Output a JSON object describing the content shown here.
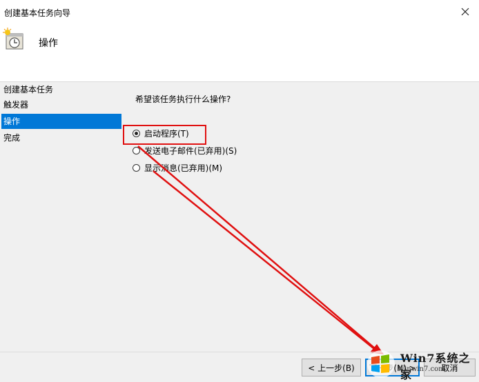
{
  "window": {
    "title": "创建基本任务向导"
  },
  "header": {
    "title": "操作",
    "icon": "task-clock-icon"
  },
  "sidebar": {
    "items": [
      {
        "label": "创建基本任务",
        "active": false
      },
      {
        "label": "触发器",
        "active": false
      },
      {
        "label": "操作",
        "active": true
      },
      {
        "label": "完成",
        "active": false
      }
    ]
  },
  "main": {
    "question": "希望该任务执行什么操作?",
    "options": [
      {
        "label": "启动程序(T)",
        "checked": true
      },
      {
        "label": "发送电子邮件(已弃用)(S)",
        "checked": false
      },
      {
        "label": "显示消息(已弃用)(M)",
        "checked": false
      }
    ]
  },
  "footer": {
    "back_label": "< 上一步(B)",
    "next_label": "下一步(N) >",
    "cancel_label": "取消"
  },
  "watermark": {
    "text": "Win7系统之家",
    "url": "Winwin7.com"
  },
  "colors": {
    "accent": "#0078d7",
    "annotation": "#e01010"
  }
}
